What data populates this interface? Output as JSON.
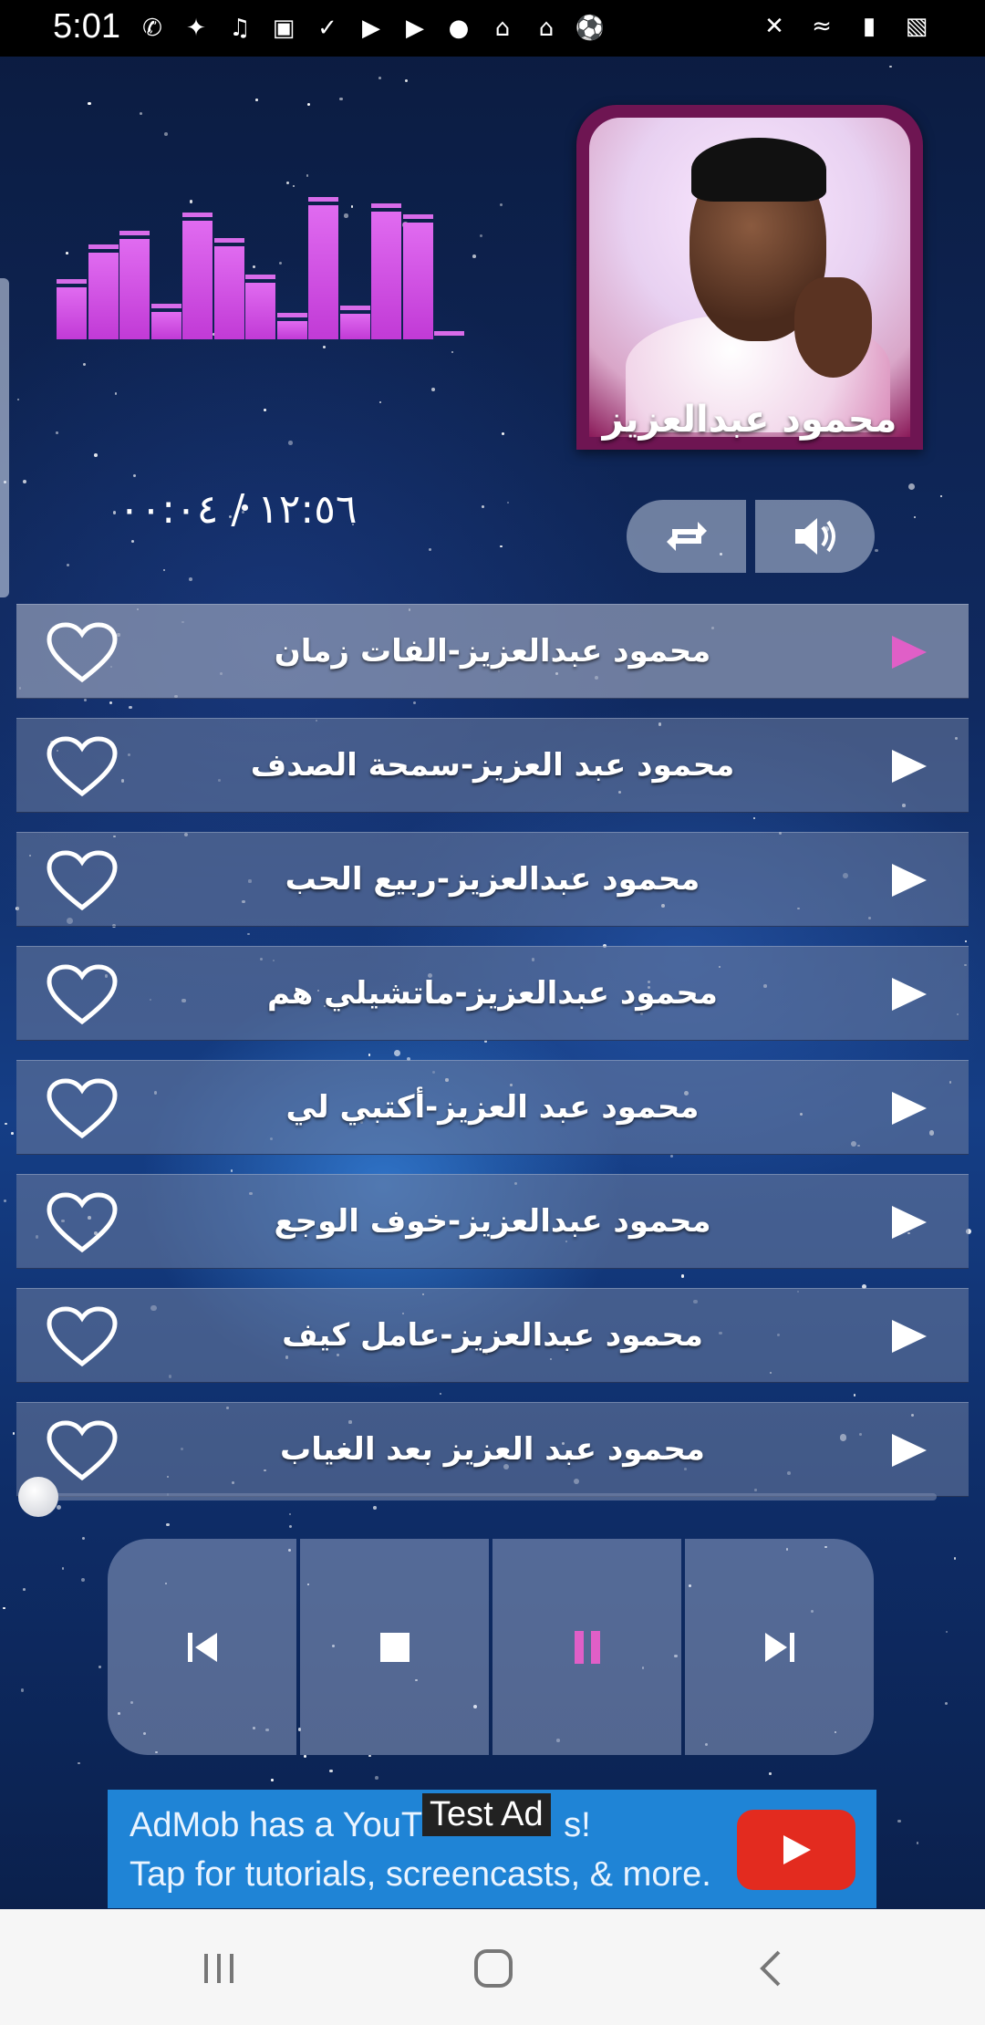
{
  "status_bar": {
    "time": "5:01"
  },
  "player": {
    "album_caption": "محمود عبدالعزيز",
    "time_display": "١٢:٥٦ / ٠٠:٠٤",
    "progress": 0.0
  },
  "playlist": [
    {
      "title": "محمود عبدالعزيز-الفات زمان",
      "active": true
    },
    {
      "title": "محمود عبد العزيز-سمحة الصدف",
      "active": false
    },
    {
      "title": "محمود عبدالعزيز-ربيع الحب",
      "active": false
    },
    {
      "title": "محمود عبدالعزيز-ماتشيلي هم",
      "active": false
    },
    {
      "title": "محمود عبد العزيز-أكتبي لي",
      "active": false
    },
    {
      "title": "محمود عبدالعزيز-خوف الوجع",
      "active": false
    },
    {
      "title": "محمود عبدالعزيز-عامل كيف",
      "active": false
    },
    {
      "title": "محمود عبد العزيز بعد الغياب",
      "active": false
    }
  ],
  "controls": {
    "repeat_icon": "repeat-icon",
    "volume_icon": "volume-icon",
    "transport_icons": [
      "previous-icon",
      "stop-icon",
      "pause-icon",
      "next-icon"
    ]
  },
  "ad": {
    "line1": "AdMob has a YouT",
    "line1_end": "s!",
    "line2": "Tap for tutorials, screencasts, & more.",
    "label": "Test Ad"
  },
  "colors": {
    "accent_pink": "#e05fc7",
    "equalizer": "#c13ad6",
    "ad_blue": "#1f84d6"
  }
}
